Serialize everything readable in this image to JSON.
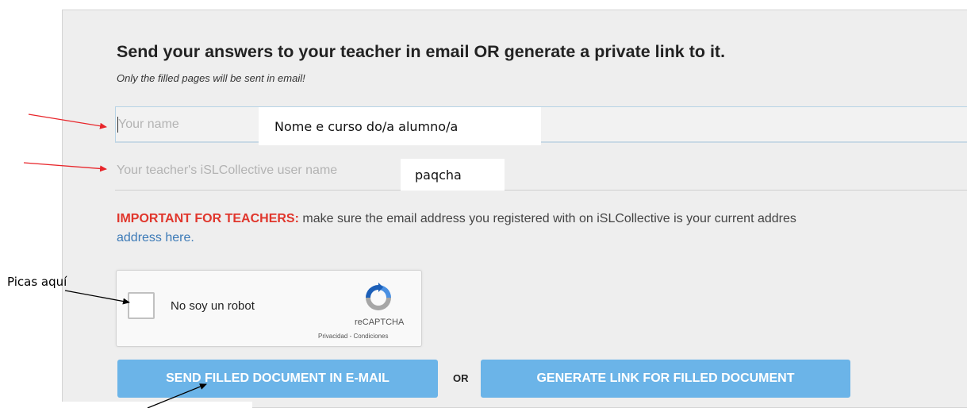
{
  "heading": "Send your answers to your teacher in email OR generate a private link to it.",
  "subnote": "Only the filled pages will be sent in email!",
  "form": {
    "name_placeholder": "Your name",
    "name_value": "Nome e curso do/a alumno/a",
    "teacher_placeholder": "Your teacher's iSLCollective user name",
    "teacher_value": "paqcha"
  },
  "important": {
    "label": "IMPORTANT FOR TEACHERS:",
    "text": " make sure the email address you registered with on iSLCollective is your current addres",
    "link": "address here."
  },
  "captcha": {
    "label": "No soy un robot",
    "brand": "reCAPTCHA",
    "terms": "Privacidad - Condiciones"
  },
  "buttons": {
    "send": "SEND FILLED DOCUMENT IN E-MAIL",
    "or": "OR",
    "generate": "GENERATE LINK FOR FILLED DOCUMENT"
  },
  "annotations": {
    "picas": "Picas aquí"
  },
  "colors": {
    "panel_bg": "#eeeeee",
    "button_blue": "#6bb4e8",
    "important_red": "#e0362c",
    "link_blue": "#3c7ab7",
    "arrow_red": "#e8252a"
  }
}
